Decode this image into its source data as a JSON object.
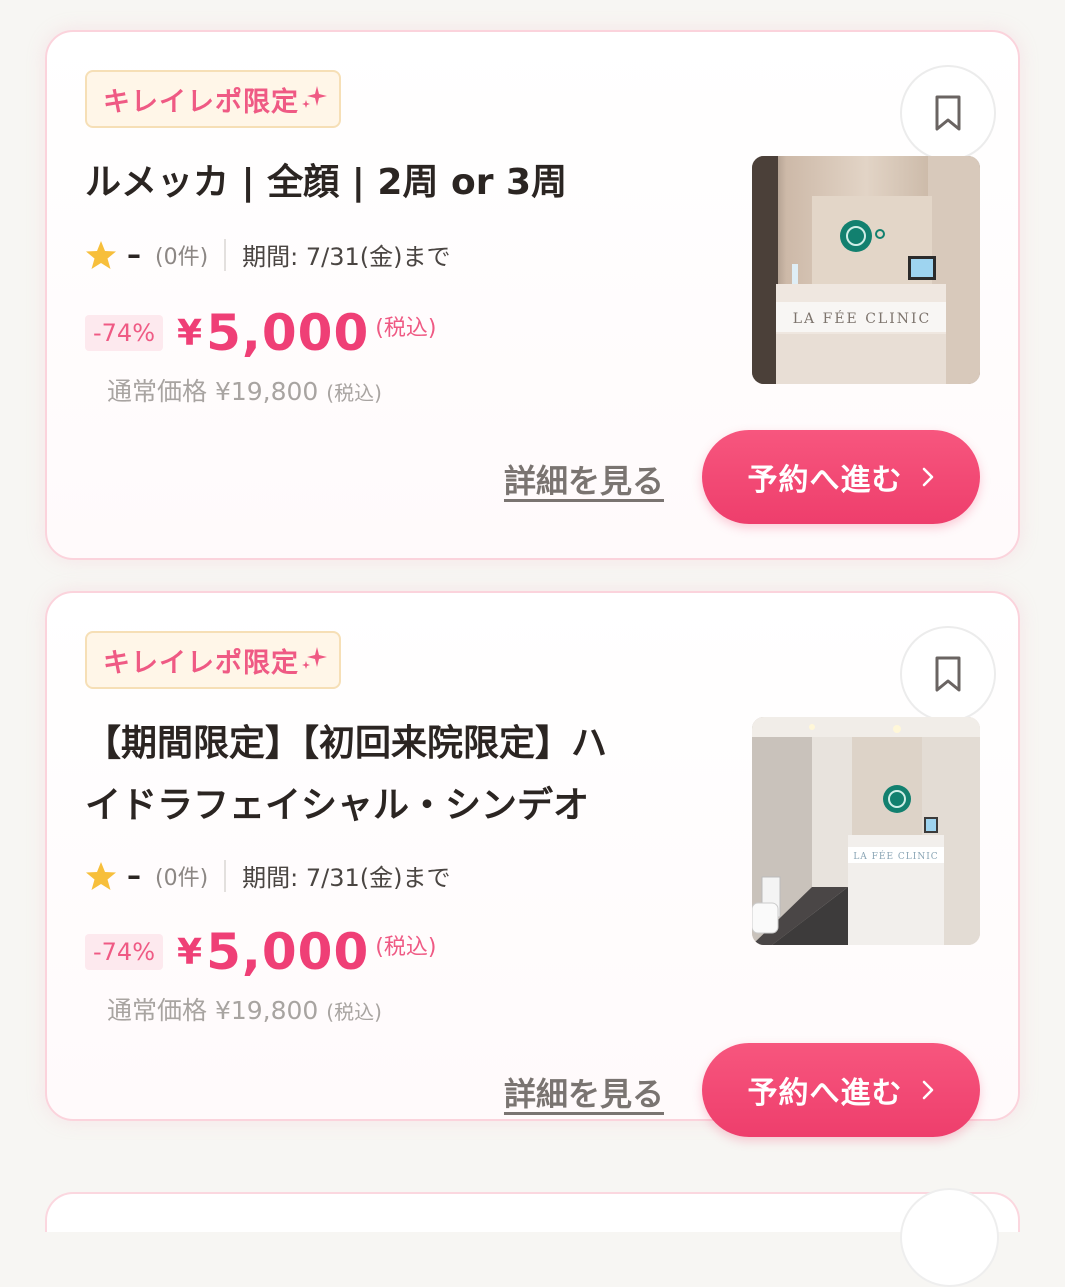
{
  "colors": {
    "accent": "#ef3f76",
    "button": "#ee3e6c",
    "badge_bg": "#fff6e8",
    "badge_text": "#ef5a84",
    "card_border": "#fbd3dc",
    "star": "#f7bf3b"
  },
  "cards": [
    {
      "badge": "キレイレポ限定",
      "title_lines": [
        "ルメッカ | 全顔 | 2周 or 3周"
      ],
      "rating": "–",
      "review_count": "(0件)",
      "period": "期間: 7/31(金)まで",
      "discount": "-74%",
      "currency": "¥",
      "price": "5,000",
      "tax": "(税込)",
      "regular_label": "通常価格 ¥19,800",
      "regular_tax": "(税込)",
      "detail_link": "詳細を見る",
      "reserve_label": "予約へ進む",
      "image_sign": "LA FÉE CLINIC",
      "icons": [
        "sparkle-icon",
        "bookmark-icon",
        "star-icon",
        "chevron-right-icon"
      ]
    },
    {
      "badge": "キレイレポ限定",
      "title_lines": [
        "【期間限定】【初回来院限定】ハ",
        "イドラフェイシャル・シンデオ"
      ],
      "rating": "–",
      "review_count": "(0件)",
      "period": "期間: 7/31(金)まで",
      "discount": "-74%",
      "currency": "¥",
      "price": "5,000",
      "tax": "(税込)",
      "regular_label": "通常価格 ¥19,800",
      "regular_tax": "(税込)",
      "detail_link": "詳細を見る",
      "reserve_label": "予約へ進む",
      "image_sign": "LA FÉE CLINIC",
      "icons": [
        "sparkle-icon",
        "bookmark-icon",
        "star-icon",
        "chevron-right-icon"
      ]
    }
  ]
}
